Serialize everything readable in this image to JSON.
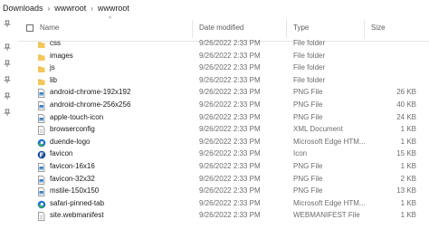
{
  "breadcrumb": [
    "Downloads",
    "wwwroot",
    "wwwroot"
  ],
  "breadcrumb_separator": "›",
  "columns": {
    "name": "Name",
    "date": "Date modified",
    "type": "Type",
    "size": "Size"
  },
  "sort_indicator": "^",
  "colors": {
    "folder": "#e8b84a",
    "edge_blue": "#1e72c9",
    "edge_green": "#3bb54a",
    "file_border": "#7a7a7a",
    "header_text": "#5d5d5d",
    "meta_text": "#6d6d6d"
  },
  "files": [
    {
      "name": "css",
      "date": "9/26/2022 2:33 PM",
      "type": "File folder",
      "size": "",
      "icon": "folder-icon"
    },
    {
      "name": "images",
      "date": "9/26/2022 2:33 PM",
      "type": "File folder",
      "size": "",
      "icon": "folder-icon"
    },
    {
      "name": "js",
      "date": "9/26/2022 2:33 PM",
      "type": "File folder",
      "size": "",
      "icon": "folder-icon"
    },
    {
      "name": "lib",
      "date": "9/26/2022 2:33 PM",
      "type": "File folder",
      "size": "",
      "icon": "folder-icon"
    },
    {
      "name": "android-chrome-192x192",
      "date": "9/26/2022 2:33 PM",
      "type": "PNG File",
      "size": "26 KB",
      "icon": "image-file-icon"
    },
    {
      "name": "android-chrome-256x256",
      "date": "9/26/2022 2:33 PM",
      "type": "PNG File",
      "size": "40 KB",
      "icon": "image-file-icon"
    },
    {
      "name": "apple-touch-icon",
      "date": "9/26/2022 2:33 PM",
      "type": "PNG File",
      "size": "24 KB",
      "icon": "image-file-icon"
    },
    {
      "name": "browserconfig",
      "date": "9/26/2022 2:33 PM",
      "type": "XML Document",
      "size": "1 KB",
      "icon": "document-icon"
    },
    {
      "name": "duende-logo",
      "date": "9/26/2022 2:33 PM",
      "type": "Microsoft Edge HTM...",
      "size": "1 KB",
      "icon": "edge-icon"
    },
    {
      "name": "favicon",
      "date": "9/26/2022 2:33 PM",
      "type": "Icon",
      "size": "15 KB",
      "icon": "ico-file-icon"
    },
    {
      "name": "favicon-16x16",
      "date": "9/26/2022 2:33 PM",
      "type": "PNG File",
      "size": "1 KB",
      "icon": "image-file-icon"
    },
    {
      "name": "favicon-32x32",
      "date": "9/26/2022 2:33 PM",
      "type": "PNG File",
      "size": "2 KB",
      "icon": "image-file-icon"
    },
    {
      "name": "mstile-150x150",
      "date": "9/26/2022 2:33 PM",
      "type": "PNG File",
      "size": "13 KB",
      "icon": "image-file-icon"
    },
    {
      "name": "safari-pinned-tab",
      "date": "9/26/2022 2:33 PM",
      "type": "Microsoft Edge HTM...",
      "size": "1 KB",
      "icon": "edge-icon"
    },
    {
      "name": "site.webmanifest",
      "date": "9/26/2022 2:33 PM",
      "type": "WEBMANIFEST File",
      "size": "1 KB",
      "icon": "document-icon"
    }
  ]
}
